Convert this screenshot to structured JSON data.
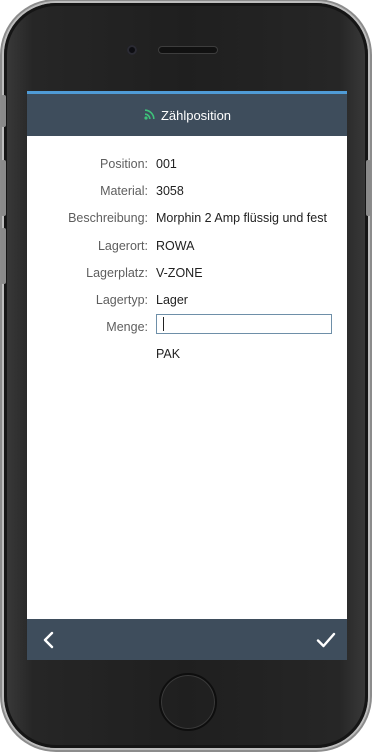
{
  "header": {
    "title": "Zählposition",
    "icon": "wifi-icon",
    "accent_color": "#4f9bd6",
    "icon_color": "#3ec27a"
  },
  "form": {
    "position": {
      "label": "Position:",
      "value": "001"
    },
    "material": {
      "label": "Material:",
      "value": "3058"
    },
    "beschreibung": {
      "label": "Beschreibung:",
      "value": "Morphin 2 Amp flüssig und fest"
    },
    "lagerort": {
      "label": "Lagerort:",
      "value": "ROWA"
    },
    "lagerplatz": {
      "label": "Lagerplatz:",
      "value": "V-ZONE"
    },
    "lagertyp": {
      "label": "Lagertyp:",
      "value": "Lager"
    },
    "menge": {
      "label": "Menge:",
      "value": "",
      "unit": "PAK"
    }
  },
  "footer": {
    "back_icon": "chevron-left-icon",
    "confirm_icon": "checkmark-icon"
  }
}
